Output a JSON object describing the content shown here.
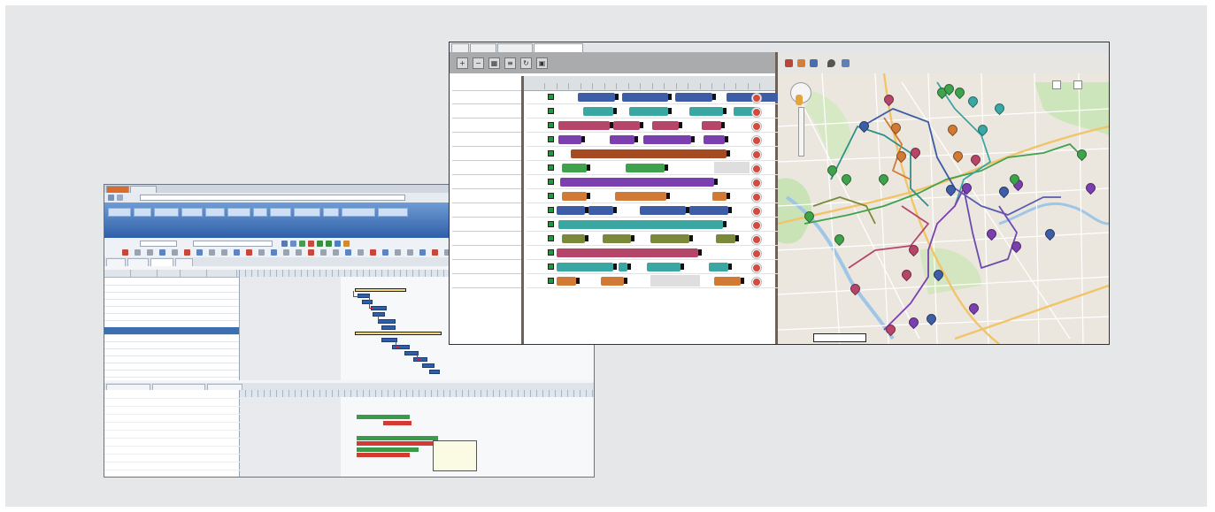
{
  "project_window": {
    "tabs": [
      "",
      ""
    ],
    "address": "",
    "menu_items": [
      "",
      "",
      "",
      "",
      "",
      "",
      "",
      "",
      "",
      "",
      "",
      ""
    ],
    "selects": [
      "",
      ""
    ],
    "subtabs": [
      "",
      "",
      "",
      ""
    ],
    "grid_columns": [
      "",
      "",
      "",
      "",
      ""
    ],
    "grid_rows": [
      {
        "cells": [
          "",
          "",
          "",
          "",
          ""
        ],
        "selected": false
      },
      {
        "cells": [
          "",
          "",
          "",
          "",
          ""
        ],
        "selected": false
      },
      {
        "cells": [
          "",
          "",
          "",
          "",
          ""
        ],
        "selected": false
      },
      {
        "cells": [
          "",
          "",
          "",
          "",
          ""
        ],
        "selected": false
      },
      {
        "cells": [
          "",
          "",
          "",
          "",
          ""
        ],
        "selected": false
      },
      {
        "cells": [
          "",
          "",
          "",
          "",
          ""
        ],
        "selected": false
      },
      {
        "cells": [
          "",
          "",
          "",
          "",
          ""
        ],
        "selected": false
      },
      {
        "cells": [
          "",
          "",
          "",
          "",
          ""
        ],
        "selected": true
      },
      {
        "cells": [
          "",
          "",
          "",
          "",
          ""
        ],
        "selected": false
      },
      {
        "cells": [
          "",
          "",
          "",
          "",
          ""
        ],
        "selected": false
      },
      {
        "cells": [
          "",
          "",
          "",
          "",
          ""
        ],
        "selected": false
      },
      {
        "cells": [
          "",
          "",
          "",
          "",
          ""
        ],
        "selected": false
      },
      {
        "cells": [
          "",
          "",
          "",
          "",
          ""
        ],
        "selected": false
      },
      {
        "cells": [
          "",
          "",
          "",
          "",
          ""
        ],
        "selected": false
      }
    ],
    "lower_tabs": [
      "",
      "",
      ""
    ],
    "resource_rows": [
      "",
      "",
      "",
      "",
      "",
      "",
      "",
      "",
      "",
      ""
    ],
    "tooltip_lines": [
      "",
      "",
      "",
      "",
      ""
    ]
  },
  "dispatch_window": {
    "tabs": [
      "",
      "",
      "",
      ""
    ],
    "active_tab": 3,
    "toolbar_buttons": [
      "",
      "",
      "",
      "",
      "",
      ""
    ],
    "name_header": "",
    "timeline_date": "",
    "timeline_ticks": [
      "",
      "",
      "",
      "",
      "",
      "",
      "",
      "",
      "",
      "",
      "",
      "",
      "",
      "",
      "",
      "",
      "",
      "",
      ""
    ],
    "technicians": [
      "",
      "",
      "",
      "",
      "",
      "",
      "",
      "",
      "",
      "",
      "",
      "",
      "",
      ""
    ],
    "map_buttons": [
      "",
      ""
    ],
    "scale_label": "",
    "colors": {
      "teal": "#3aa7a3",
      "purple": "#7b3fb0",
      "blue": "#3d5da6",
      "brown": "#a64a22",
      "green": "#3fa24c",
      "rose": "#b6456a",
      "orange": "#d07a35",
      "olive": "#7a8a3a"
    }
  }
}
